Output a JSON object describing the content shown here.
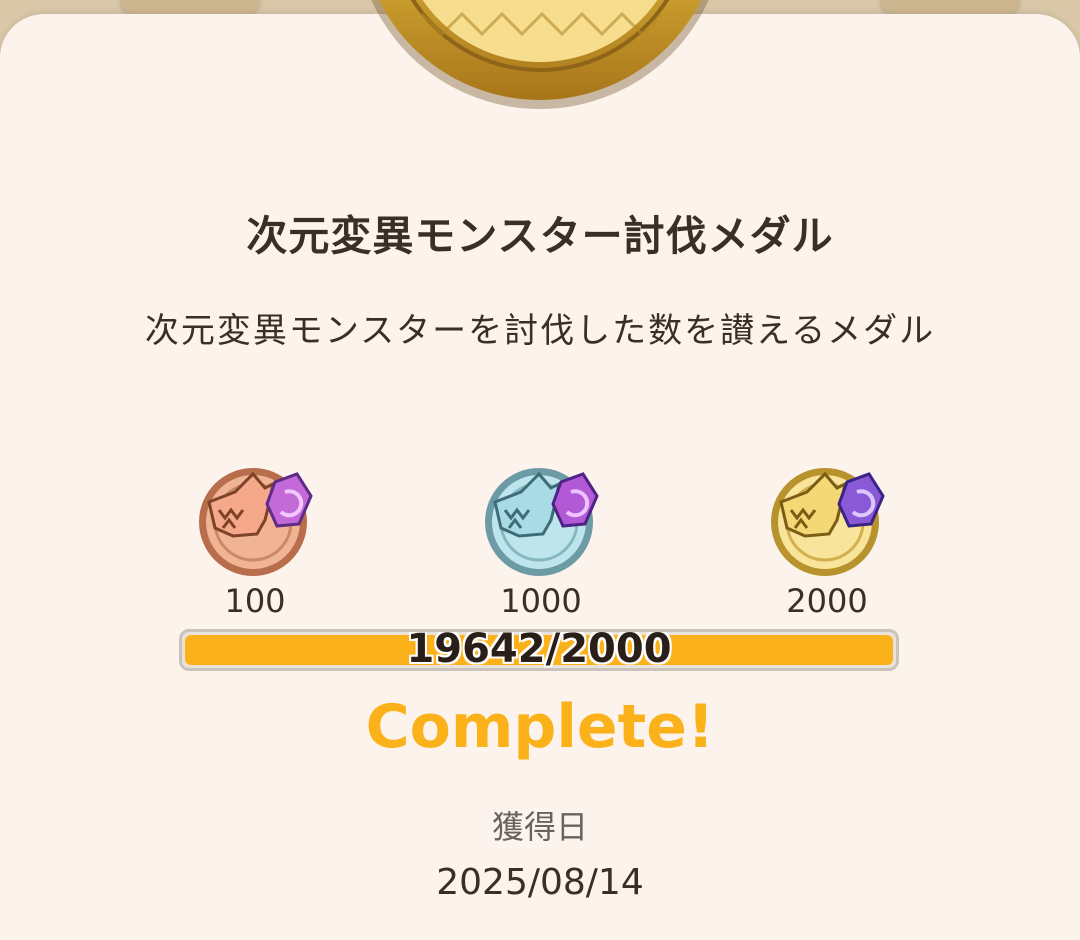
{
  "medal": {
    "title": "次元変異モンスター討伐メダル",
    "description": "次元変異モンスターを討伐した数を讃えるメダル"
  },
  "tiers": [
    {
      "threshold": "100",
      "icon": "bronze-monster-medal-icon",
      "color": "#e7a07e"
    },
    {
      "threshold": "1000",
      "icon": "silver-monster-medal-icon",
      "color": "#9fd3dd"
    },
    {
      "threshold": "2000",
      "icon": "gold-monster-medal-icon",
      "color": "#f1d36f"
    }
  ],
  "progress": {
    "text": "19642/2000",
    "fraction": 1.0,
    "fill_color": "#fbb21a"
  },
  "status": {
    "complete_label": "Complete!"
  },
  "earned": {
    "label": "獲得日",
    "date": "2025/08/14"
  },
  "colors": {
    "accent": "#fbb21a",
    "card_background": "#fbf3ec",
    "text": "#3a2e26"
  }
}
